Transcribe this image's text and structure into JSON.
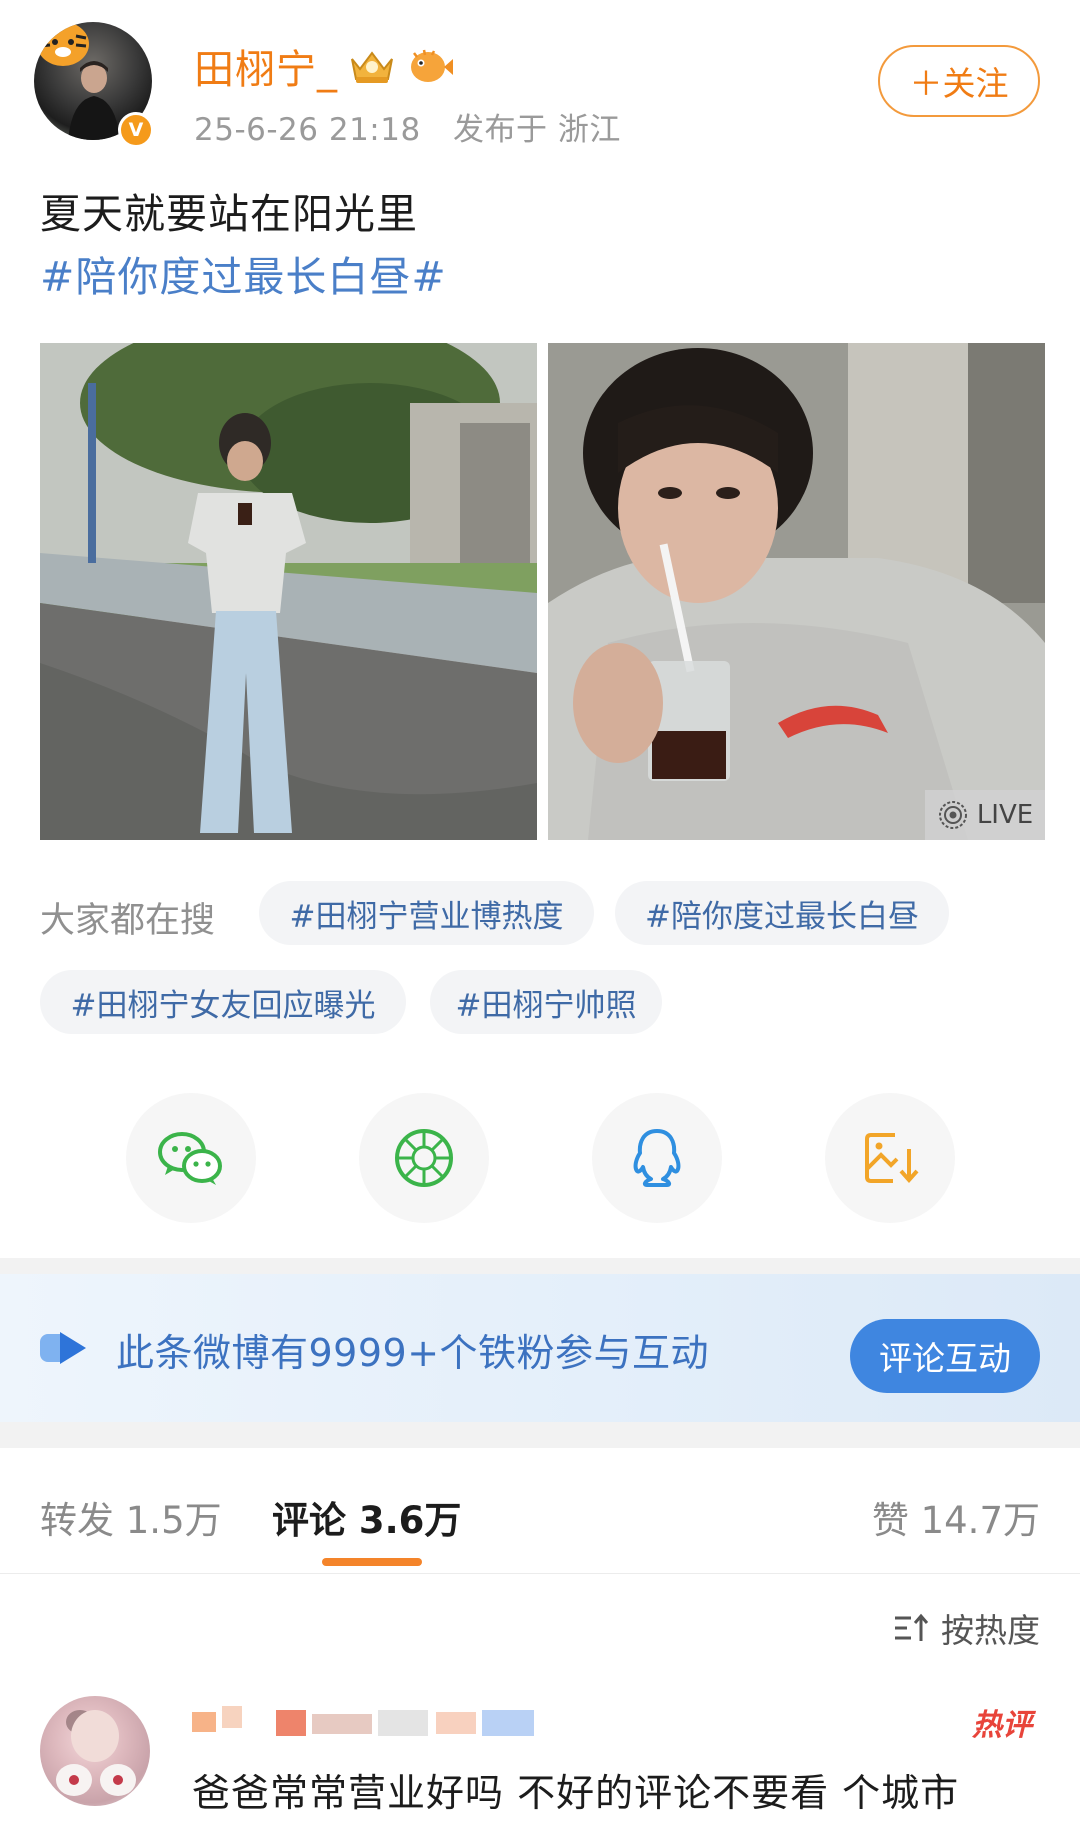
{
  "post": {
    "author": {
      "name": "田栩宁_",
      "verified_mark": "V"
    },
    "time": "25-6-26 21:18",
    "location": "发布于 浙江",
    "follow_label": "＋关注",
    "text": "夏天就要站在阳光里",
    "topic": "#陪你度过最长白昼#",
    "images": [
      {
        "icon": "photo-street-icon"
      },
      {
        "icon": "photo-closeup-icon",
        "live_label": "LIVE"
      }
    ]
  },
  "search": {
    "label": "大家都在搜",
    "tags": [
      "#田栩宁营业博热度",
      "#陪你度过最长白昼",
      "#田栩宁女友回应曝光",
      "#田栩宁帅照"
    ]
  },
  "share": [
    {
      "name": "wechat-icon",
      "color": "#3bb44a"
    },
    {
      "name": "moments-icon",
      "color": "#3bb44a"
    },
    {
      "name": "qq-icon",
      "color": "#2f8fe0"
    },
    {
      "name": "save-image-icon",
      "color": "#f2a528"
    }
  ],
  "fans_banner": {
    "text": "此条微博有9999+个铁粉参与互动",
    "button": "评论互动"
  },
  "tabs": {
    "repost": "转发 1.5万",
    "comments": "评论 3.6万",
    "likes": "赞 14.7万"
  },
  "sort_label": "按热度",
  "comment": {
    "hot_label": "热评",
    "text": "爸爸常常营业好吗 不好的评论不要看 个城市"
  },
  "colors": {
    "accent_orange": "#f07c14",
    "topic_blue": "#4a7fc8",
    "button_blue": "#3f86e0"
  }
}
